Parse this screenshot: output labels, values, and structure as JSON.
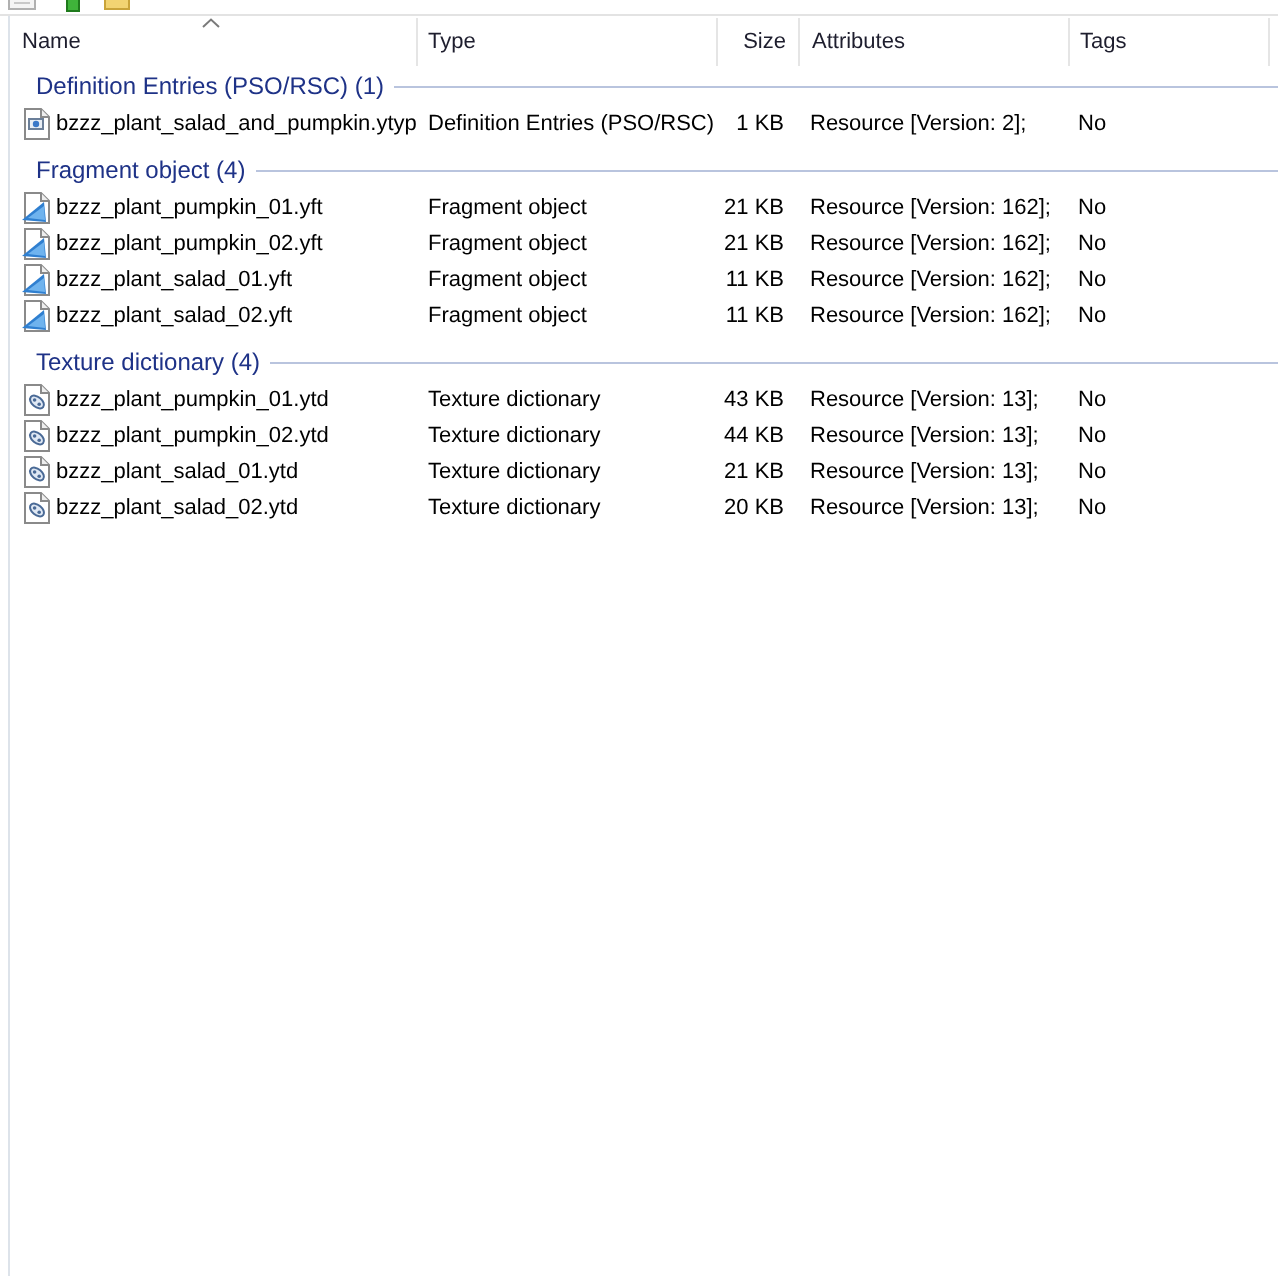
{
  "columns": [
    {
      "label": "Name",
      "sorted": true
    },
    {
      "label": "Type",
      "sorted": false
    },
    {
      "label": "Size",
      "sorted": false
    },
    {
      "label": "Attributes",
      "sorted": false
    },
    {
      "label": "Tags",
      "sorted": false
    }
  ],
  "groups": [
    {
      "title": "Definition Entries (PSO/RSC) (1)",
      "items": [
        {
          "kind": "ytyp",
          "name": "bzzz_plant_salad_and_pumpkin.ytyp",
          "type": "Definition Entries (PSO/RSC)",
          "size": "1 KB",
          "attributes": "Resource [Version: 2];",
          "tags": "No"
        }
      ]
    },
    {
      "title": "Fragment object (4)",
      "items": [
        {
          "kind": "yft",
          "name": "bzzz_plant_pumpkin_01.yft",
          "type": "Fragment object",
          "size": "21 KB",
          "attributes": "Resource [Version: 162];",
          "tags": "No"
        },
        {
          "kind": "yft",
          "name": "bzzz_plant_pumpkin_02.yft",
          "type": "Fragment object",
          "size": "21 KB",
          "attributes": "Resource [Version: 162];",
          "tags": "No"
        },
        {
          "kind": "yft",
          "name": "bzzz_plant_salad_01.yft",
          "type": "Fragment object",
          "size": "11 KB",
          "attributes": "Resource [Version: 162];",
          "tags": "No"
        },
        {
          "kind": "yft",
          "name": "bzzz_plant_salad_02.yft",
          "type": "Fragment object",
          "size": "11 KB",
          "attributes": "Resource [Version: 162];",
          "tags": "No"
        }
      ]
    },
    {
      "title": "Texture dictionary (4)",
      "items": [
        {
          "kind": "ytd",
          "name": "bzzz_plant_pumpkin_01.ytd",
          "type": "Texture dictionary",
          "size": "43 KB",
          "attributes": "Resource [Version: 13];",
          "tags": "No"
        },
        {
          "kind": "ytd",
          "name": "bzzz_plant_pumpkin_02.ytd",
          "type": "Texture dictionary",
          "size": "44 KB",
          "attributes": "Resource [Version: 13];",
          "tags": "No"
        },
        {
          "kind": "ytd",
          "name": "bzzz_plant_salad_01.ytd",
          "type": "Texture dictionary",
          "size": "21 KB",
          "attributes": "Resource [Version: 13];",
          "tags": "No"
        },
        {
          "kind": "ytd",
          "name": "bzzz_plant_salad_02.ytd",
          "type": "Texture dictionary",
          "size": "20 KB",
          "attributes": "Resource [Version: 13];",
          "tags": "No"
        }
      ]
    }
  ]
}
